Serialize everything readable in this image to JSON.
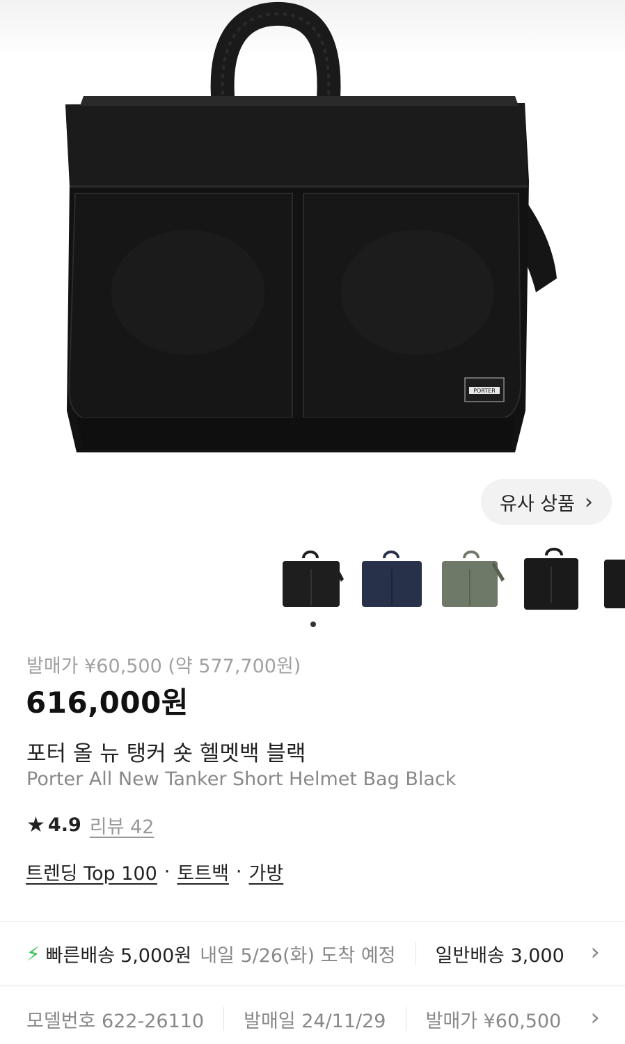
{
  "hero": {
    "image": "black-helmet-bag-photo",
    "brand_tag": "PORTER"
  },
  "similar_products": {
    "label": "유사 상품",
    "icon": "chevron-right-icon"
  },
  "thumbnails": [
    {
      "name": "black-bag",
      "color": "#1e1e1e"
    },
    {
      "name": "navy-bag",
      "color": "#27324a"
    },
    {
      "name": "sage-bag",
      "color": "#6e7a67"
    },
    {
      "name": "black-tall-bag",
      "color": "#1a1a1a"
    },
    {
      "name": "black-partial-bag",
      "color": "#1a1a1a"
    }
  ],
  "carousel": {
    "active_index": 1
  },
  "release_price": "발매가 ¥60,500 (약 577,700원)",
  "price": "616,000원",
  "title_ko": "포터 올 뉴 탱커 숏 헬멧백 블랙",
  "title_en": "Porter All New Tanker Short Helmet Bag Black",
  "rating": {
    "score": "4.9",
    "reviews": "리뷰 42"
  },
  "categories": [
    "트렌딩 Top 100",
    "토트백",
    "가방"
  ],
  "shipping": {
    "fast_label": "빠른배송",
    "fast_price": "5,000원",
    "eta": "내일 5/26(화) 도착 예정",
    "normal": "일반배송 3,000"
  },
  "product_info": {
    "model": "모델번호 622-26110",
    "release_date": "발매일 24/11/29",
    "release_price": "발매가 ¥60,500"
  },
  "colors": {
    "accent_green": "#2bc24f",
    "text_muted": "#888888"
  }
}
